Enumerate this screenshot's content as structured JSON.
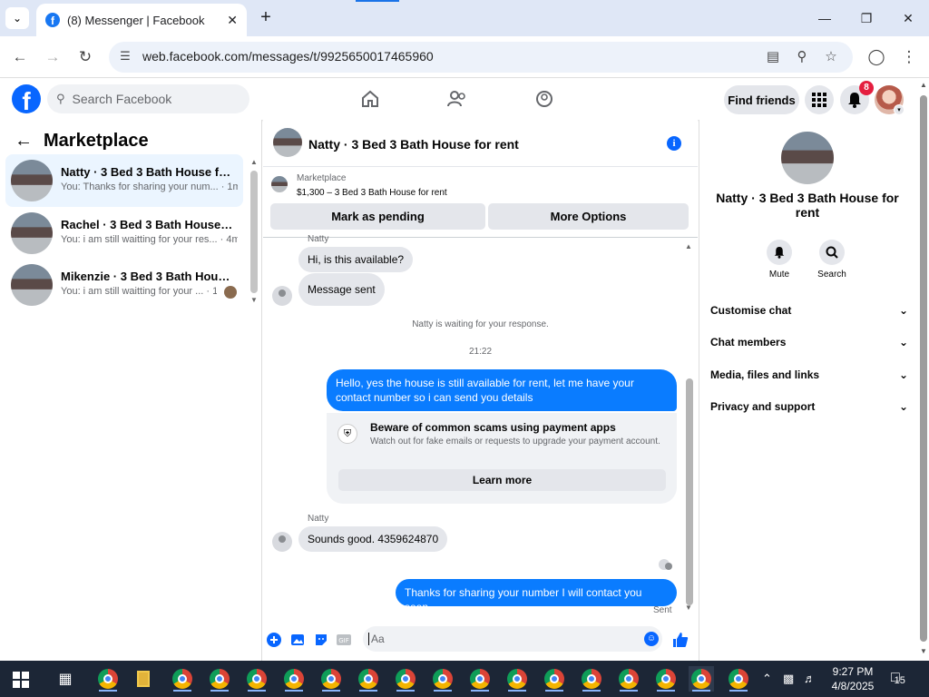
{
  "browser": {
    "tab_title": "(8) Messenger | Facebook",
    "url": "web.facebook.com/messages/t/9925650017465960"
  },
  "fb": {
    "search_placeholder": "Search Facebook",
    "find_friends": "Find friends",
    "notif_count": "8"
  },
  "left": {
    "title": "Marketplace",
    "conversations": [
      {
        "name": "Natty · 3 Bed 3 Bath House for r...",
        "preview": "You: Thanks for sharing your num... · 1m"
      },
      {
        "name": "Rachel · 3 Bed 3 Bath House for...",
        "preview": "You: i am still waitting for your res... · 4m"
      },
      {
        "name": "Mikenzie · 3 Bed 3 Bath Hous...",
        "preview": "You: i am still waitting for your ... · 1w"
      }
    ]
  },
  "chat": {
    "title": "Natty · 3 Bed 3 Bath House for rent",
    "listing_source": "Marketplace",
    "listing_price": "$1,300 – 3 Bed 3 Bath House for rent",
    "mark_pending": "Mark as pending",
    "more_options": "More Options",
    "sender_1": "Natty",
    "msg_1": "Hi, is this available?",
    "msg_2": "Message sent",
    "waiting_note": "Natty is waiting for your response.",
    "time_sep": "21:22",
    "out_1": "Hello, yes the house is still available for rent, let me have your contact number so i can send you  details",
    "scam_title": "Beware of common scams using payment apps",
    "scam_desc": "Watch out for fake emails or requests to upgrade your payment account.",
    "learn_more": "Learn more",
    "sender_2": "Natty",
    "msg_3": "Sounds good. 4359624870",
    "out_2": "Thanks for sharing your number I will contact you soon",
    "sent_label": "Sent",
    "composer_placeholder": "Aa"
  },
  "right": {
    "name": "Natty · 3 Bed 3 Bath House for rent",
    "mute": "Mute",
    "search": "Search",
    "sections": [
      "Customise chat",
      "Chat members",
      "Media, files and links",
      "Privacy and support"
    ]
  },
  "taskbar": {
    "time": "9:27 PM",
    "date": "4/8/2025",
    "notif_count": "15"
  }
}
